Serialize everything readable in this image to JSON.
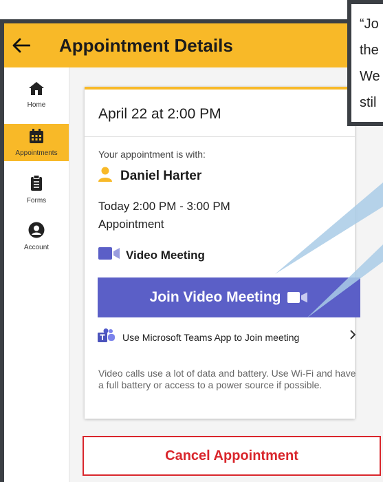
{
  "appbar": {
    "title": "Appointment Details"
  },
  "sidebar": {
    "items": [
      {
        "label": "Home",
        "active": false
      },
      {
        "label": "Appointments",
        "active": true
      },
      {
        "label": "Forms",
        "active": false
      },
      {
        "label": "Account",
        "active": false
      }
    ]
  },
  "card": {
    "date": "April 22 at 2:00 PM",
    "with_label": "Your appointment is with:",
    "provider": "Daniel Harter",
    "time_range": "Today 2:00 PM - 3:00 PM",
    "type": "Appointment",
    "video_label": "Video Meeting",
    "join_button": "Join Video Meeting",
    "teams_text": "Use Microsoft Teams App to Join meeting",
    "note": "Video calls use a lot of data and battery. Use Wi-Fi and have a full battery or access to a power source if possible."
  },
  "cancel_button": "Cancel Appointment",
  "callout": {
    "lines": [
      "“Jo",
      "the",
      "We",
      "stil"
    ]
  },
  "colors": {
    "brand": "#f8b928",
    "teams": "#5b5fc7",
    "danger": "#d9262c",
    "callout_pointer": "#a9cbe6"
  }
}
